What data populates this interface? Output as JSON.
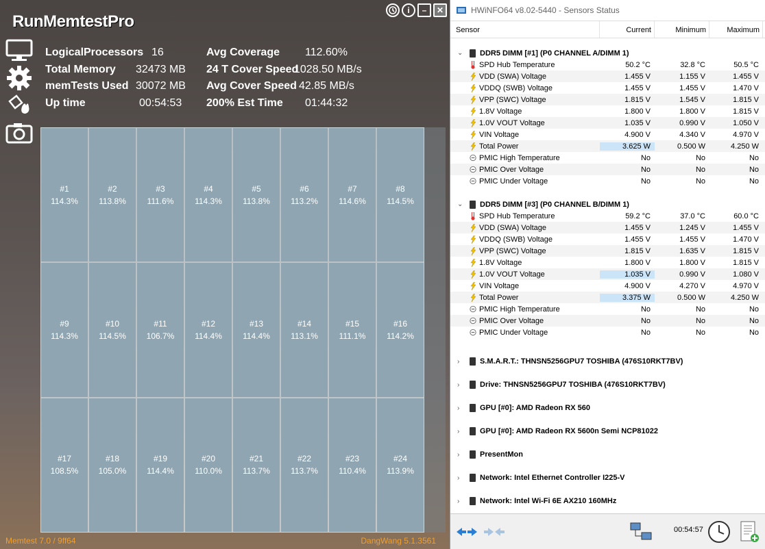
{
  "memtest": {
    "title": "RunMemtestPro",
    "stats": {
      "logical_processors_label": "LogicalProcessors",
      "logical_processors_value": "16",
      "total_memory_label": "Total Memory",
      "total_memory_value": "32473 MB",
      "memtests_used_label": "memTests Used",
      "memtests_used_value": "30072 MB",
      "uptime_label": "Up time",
      "uptime_value": "00:54:53",
      "avg_coverage_label": "Avg Coverage",
      "avg_coverage_value": "112.60%",
      "cover_speed_label": "24 T Cover Speed",
      "cover_speed_value": "1028.50 MB/s",
      "avg_cover_speed_label": "Avg Cover Speed",
      "avg_cover_speed_value": "42.85 MB/s",
      "est_time_label": "200% Est Time",
      "est_time_value": "01:44:32"
    },
    "threads": [
      {
        "id": "#1",
        "coverage": "114.3%"
      },
      {
        "id": "#2",
        "coverage": "113.8%"
      },
      {
        "id": "#3",
        "coverage": "111.6%"
      },
      {
        "id": "#4",
        "coverage": "114.3%"
      },
      {
        "id": "#5",
        "coverage": "113.8%"
      },
      {
        "id": "#6",
        "coverage": "113.2%"
      },
      {
        "id": "#7",
        "coverage": "114.6%"
      },
      {
        "id": "#8",
        "coverage": "114.5%"
      },
      {
        "id": "#9",
        "coverage": "114.3%"
      },
      {
        "id": "#10",
        "coverage": "114.5%"
      },
      {
        "id": "#11",
        "coverage": "106.7%"
      },
      {
        "id": "#12",
        "coverage": "114.4%"
      },
      {
        "id": "#13",
        "coverage": "114.4%"
      },
      {
        "id": "#14",
        "coverage": "113.1%"
      },
      {
        "id": "#15",
        "coverage": "111.1%"
      },
      {
        "id": "#16",
        "coverage": "114.2%"
      },
      {
        "id": "#17",
        "coverage": "108.5%"
      },
      {
        "id": "#18",
        "coverage": "105.0%"
      },
      {
        "id": "#19",
        "coverage": "114.4%"
      },
      {
        "id": "#20",
        "coverage": "110.0%"
      },
      {
        "id": "#21",
        "coverage": "113.7%"
      },
      {
        "id": "#22",
        "coverage": "113.7%"
      },
      {
        "id": "#23",
        "coverage": "110.4%"
      },
      {
        "id": "#24",
        "coverage": "113.9%"
      }
    ],
    "footer_left": "Memtest 7.0 / 9ff64",
    "footer_right": "DangWang 5.1.3561",
    "accent_color": "#f0a030"
  },
  "hwinfo": {
    "window_title": "HWiNFO64 v8.02-5440 - Sensors Status",
    "columns": {
      "sensor": "Sensor",
      "current": "Current",
      "minimum": "Minimum",
      "maximum": "Maximum"
    },
    "groups": [
      {
        "name": "DDR5 DIMM [#1] (P0 CHANNEL A/DIMM 1)",
        "rows": [
          {
            "icon": "thermometer",
            "label": "SPD Hub Temperature",
            "current": "50.2 °C",
            "min": "32.8 °C",
            "max": "50.5 °C",
            "hl": false
          },
          {
            "icon": "bolt",
            "label": "VDD (SWA) Voltage",
            "current": "1.455 V",
            "min": "1.155 V",
            "max": "1.455 V",
            "hl": false
          },
          {
            "icon": "bolt",
            "label": "VDDQ (SWB) Voltage",
            "current": "1.455 V",
            "min": "1.455 V",
            "max": "1.470 V",
            "hl": false
          },
          {
            "icon": "bolt",
            "label": "VPP (SWC) Voltage",
            "current": "1.815 V",
            "min": "1.545 V",
            "max": "1.815 V",
            "hl": false
          },
          {
            "icon": "bolt",
            "label": "1.8V Voltage",
            "current": "1.800 V",
            "min": "1.800 V",
            "max": "1.815 V",
            "hl": false
          },
          {
            "icon": "bolt",
            "label": "1.0V VOUT Voltage",
            "current": "1.035 V",
            "min": "0.990 V",
            "max": "1.050 V",
            "hl": false
          },
          {
            "icon": "bolt",
            "label": "VIN Voltage",
            "current": "4.900 V",
            "min": "4.340 V",
            "max": "4.970 V",
            "hl": false
          },
          {
            "icon": "bolt",
            "label": "Total Power",
            "current": "3.625 W",
            "min": "0.500 W",
            "max": "4.250 W",
            "hl": true
          },
          {
            "icon": "status",
            "label": "PMIC High Temperature",
            "current": "No",
            "min": "No",
            "max": "No",
            "hl": false
          },
          {
            "icon": "status",
            "label": "PMIC Over Voltage",
            "current": "No",
            "min": "No",
            "max": "No",
            "hl": false
          },
          {
            "icon": "status",
            "label": "PMIC Under Voltage",
            "current": "No",
            "min": "No",
            "max": "No",
            "hl": false
          }
        ]
      },
      {
        "name": "DDR5 DIMM [#3] (P0 CHANNEL B/DIMM 1)",
        "rows": [
          {
            "icon": "thermometer",
            "label": "SPD Hub Temperature",
            "current": "59.2 °C",
            "min": "37.0 °C",
            "max": "60.0 °C",
            "hl": false
          },
          {
            "icon": "bolt",
            "label": "VDD (SWA) Voltage",
            "current": "1.455 V",
            "min": "1.245 V",
            "max": "1.455 V",
            "hl": false
          },
          {
            "icon": "bolt",
            "label": "VDDQ (SWB) Voltage",
            "current": "1.455 V",
            "min": "1.455 V",
            "max": "1.470 V",
            "hl": false
          },
          {
            "icon": "bolt",
            "label": "VPP (SWC) Voltage",
            "current": "1.815 V",
            "min": "1.635 V",
            "max": "1.815 V",
            "hl": false
          },
          {
            "icon": "bolt",
            "label": "1.8V Voltage",
            "current": "1.800 V",
            "min": "1.800 V",
            "max": "1.815 V",
            "hl": false
          },
          {
            "icon": "bolt",
            "label": "1.0V VOUT Voltage",
            "current": "1.035 V",
            "min": "0.990 V",
            "max": "1.080 V",
            "hl": true
          },
          {
            "icon": "bolt",
            "label": "VIN Voltage",
            "current": "4.900 V",
            "min": "4.270 V",
            "max": "4.970 V",
            "hl": false
          },
          {
            "icon": "bolt",
            "label": "Total Power",
            "current": "3.375 W",
            "min": "0.500 W",
            "max": "4.250 W",
            "hl": true
          },
          {
            "icon": "status",
            "label": "PMIC High Temperature",
            "current": "No",
            "min": "No",
            "max": "No",
            "hl": false
          },
          {
            "icon": "status",
            "label": "PMIC Over Voltage",
            "current": "No",
            "min": "No",
            "max": "No",
            "hl": false
          },
          {
            "icon": "status",
            "label": "PMIC Under Voltage",
            "current": "No",
            "min": "No",
            "max": "No",
            "hl": false
          }
        ]
      }
    ],
    "collapsed_groups": [
      "S.M.A.R.T.: THNSN5256GPU7 TOSHIBA (476S10RKT7BV)",
      "Drive: THNSN5256GPU7 TOSHIBA (476S10RKT7BV)",
      "GPU [#0]: AMD Radeon RX 560",
      "GPU [#0]: AMD Radeon RX 5600n Semi NCP81022",
      "PresentMon",
      "Network: Intel Ethernet Controller I225-V",
      "Network: Intel Wi-Fi 6E AX210 160MHz"
    ],
    "elapsed_time": "00:54:57",
    "highlight_color": "#cce4f7"
  }
}
